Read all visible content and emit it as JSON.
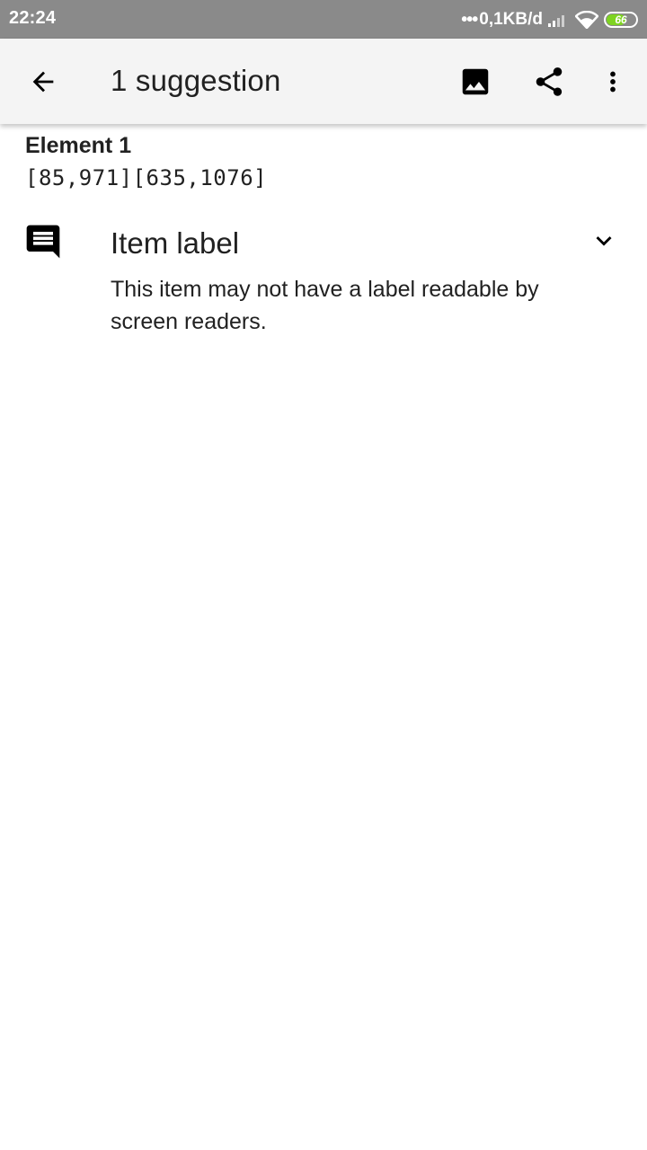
{
  "status_bar": {
    "time": "22:24",
    "dots": "•••",
    "network_speed": "0,1KB/d",
    "battery_level": "66",
    "battery_fraction": 0.66,
    "battery_color": "#7ed321",
    "icons": [
      "signal-icon",
      "wifi-icon",
      "battery-icon"
    ]
  },
  "app_bar": {
    "title": "1 suggestion",
    "icons": [
      "back-arrow-icon",
      "image-icon",
      "share-icon",
      "more-vert-icon"
    ]
  },
  "element": {
    "title": "Element 1",
    "bounds": "[85,971][635,1076]"
  },
  "suggestion": {
    "icon": "comment-icon",
    "title": "Item label",
    "description": "This item may not have a label readable by screen readers.",
    "expand_icon": "chevron-down-icon"
  }
}
